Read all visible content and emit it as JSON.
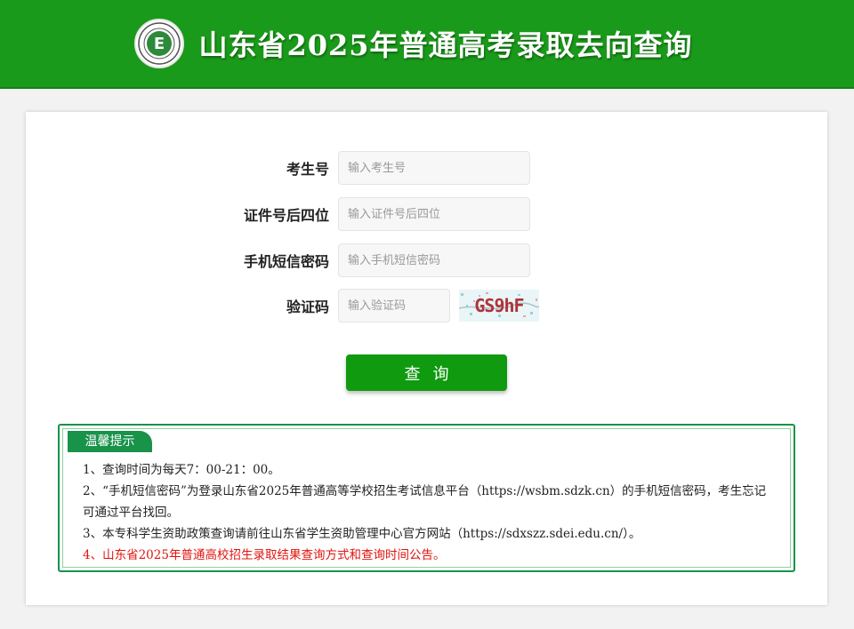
{
  "header": {
    "title": "山东省2025年普通高考录取去向查询",
    "logo_icon": "exam-authority-seal-icon"
  },
  "form": {
    "exam_number": {
      "label": "考生号",
      "placeholder": "输入考生号",
      "value": ""
    },
    "id_last4": {
      "label": "证件号后四位",
      "placeholder": "输入证件号后四位",
      "value": ""
    },
    "sms_password": {
      "label": "手机短信密码",
      "placeholder": "输入手机短信密码",
      "value": ""
    },
    "captcha": {
      "label": "验证码",
      "placeholder": "输入验证码",
      "value": "",
      "image_text": "GS9hF"
    },
    "submit_label": "查询"
  },
  "notice": {
    "title": "温馨提示",
    "items": [
      "1、查询时间为每天7：00-21：00。",
      "2、“手机短信密码”为登录山东省2025年普通高等学校招生考试信息平台（https://wsbm.sdzk.cn）的手机短信密码，考生忘记可通过平台找回。",
      "3、本专科学生资助政策查询请前往山东省学生资助管理中心官方网站（https://sdxszz.sdei.edu.cn/）。",
      "4、山东省2025年普通高校招生录取结果查询方式和查询时间公告。"
    ]
  },
  "colors": {
    "header_green": "#1a9a1a",
    "button_green": "#0f9a0f",
    "notice_green": "#19924a",
    "notice_link_red": "#e0140f"
  }
}
